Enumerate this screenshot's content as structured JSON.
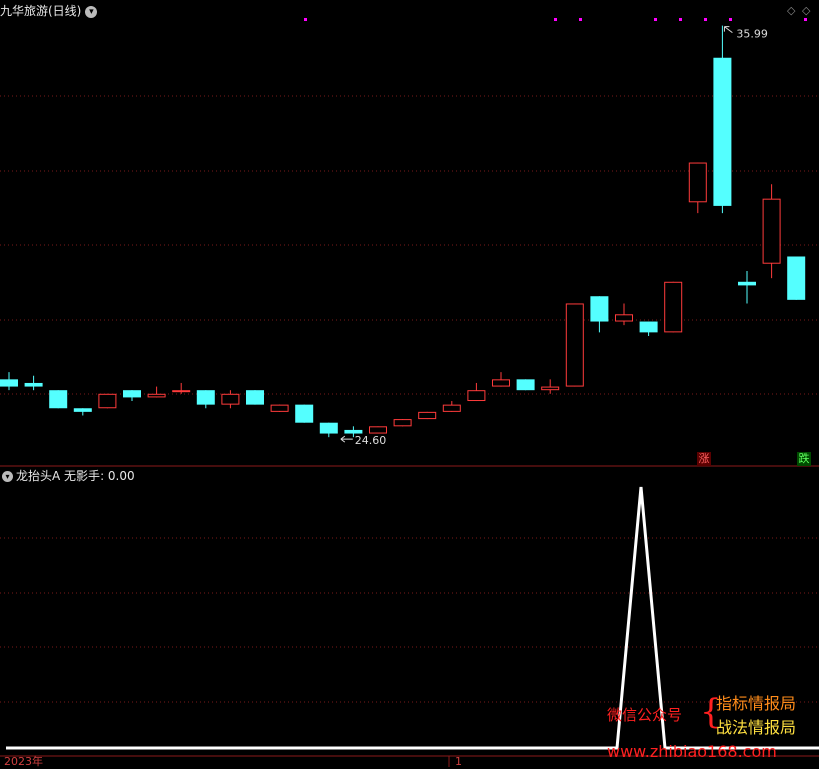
{
  "header": {
    "title": "九华旅游(日线)",
    "menu_icon": "chevron-down-icon"
  },
  "chart_data": [
    {
      "type": "candlestick",
      "title": "九华旅游(日线)",
      "annotations": {
        "high_label": "35.99",
        "low_label": "24.60"
      },
      "ylim": [
        24.3,
        36.2
      ],
      "candles": [
        {
          "o": 26.2,
          "c": 26.0,
          "h": 26.4,
          "l": 25.9
        },
        {
          "o": 26.1,
          "c": 26.0,
          "h": 26.3,
          "l": 25.9
        },
        {
          "o": 25.9,
          "c": 25.4,
          "h": 25.9,
          "l": 25.4
        },
        {
          "o": 25.4,
          "c": 25.3,
          "h": 25.4,
          "l": 25.2
        },
        {
          "o": 25.4,
          "c": 25.8,
          "h": 25.8,
          "l": 25.4
        },
        {
          "o": 25.9,
          "c": 25.7,
          "h": 25.9,
          "l": 25.6
        },
        {
          "o": 25.7,
          "c": 25.8,
          "h": 26.0,
          "l": 25.7
        },
        {
          "o": 25.9,
          "c": 25.9,
          "h": 26.1,
          "l": 25.8
        },
        {
          "o": 25.9,
          "c": 25.5,
          "h": 25.9,
          "l": 25.4
        },
        {
          "o": 25.5,
          "c": 25.8,
          "h": 25.9,
          "l": 25.4
        },
        {
          "o": 25.9,
          "c": 25.5,
          "h": 25.9,
          "l": 25.5
        },
        {
          "o": 25.3,
          "c": 25.5,
          "h": 25.5,
          "l": 25.3
        },
        {
          "o": 25.5,
          "c": 25.0,
          "h": 25.5,
          "l": 25.0
        },
        {
          "o": 25.0,
          "c": 24.7,
          "h": 25.0,
          "l": 24.6
        },
        {
          "o": 24.8,
          "c": 24.7,
          "h": 24.9,
          "l": 24.6
        },
        {
          "o": 24.7,
          "c": 24.9,
          "h": 24.9,
          "l": 24.7
        },
        {
          "o": 24.9,
          "c": 25.1,
          "h": 25.1,
          "l": 24.9
        },
        {
          "o": 25.1,
          "c": 25.3,
          "h": 25.3,
          "l": 25.1
        },
        {
          "o": 25.3,
          "c": 25.5,
          "h": 25.6,
          "l": 25.3
        },
        {
          "o": 25.6,
          "c": 25.9,
          "h": 26.1,
          "l": 25.6
        },
        {
          "o": 26.0,
          "c": 26.2,
          "h": 26.4,
          "l": 26.0
        },
        {
          "o": 26.2,
          "c": 25.9,
          "h": 26.2,
          "l": 25.9
        },
        {
          "o": 25.9,
          "c": 26.0,
          "h": 26.2,
          "l": 25.8
        },
        {
          "o": 26.0,
          "c": 28.3,
          "h": 28.3,
          "l": 26.0
        },
        {
          "o": 28.5,
          "c": 27.8,
          "h": 28.5,
          "l": 27.5
        },
        {
          "o": 27.8,
          "c": 28.0,
          "h": 28.3,
          "l": 27.7
        },
        {
          "o": 27.8,
          "c": 27.5,
          "h": 27.8,
          "l": 27.4
        },
        {
          "o": 27.5,
          "c": 28.9,
          "h": 28.9,
          "l": 27.5
        },
        {
          "o": 31.1,
          "c": 32.2,
          "h": 32.2,
          "l": 30.8
        },
        {
          "o": 35.1,
          "c": 31.0,
          "h": 35.99,
          "l": 30.8
        },
        {
          "o": 28.9,
          "c": 28.8,
          "h": 29.2,
          "l": 28.3
        },
        {
          "o": 29.4,
          "c": 31.2,
          "h": 31.6,
          "l": 29.0
        },
        {
          "o": 29.6,
          "c": 28.4,
          "h": 29.6,
          "l": 28.4
        }
      ]
    },
    {
      "type": "line",
      "title": "龙抬头A",
      "series": [
        {
          "name": "无影手",
          "current": "0.00",
          "values": [
            0,
            0,
            0,
            0,
            0,
            0,
            0,
            0,
            0,
            0,
            0,
            0,
            0,
            0,
            0,
            0,
            0,
            0,
            0,
            0,
            0,
            0,
            0,
            0,
            0,
            1,
            0,
            0,
            0,
            0,
            0,
            0,
            0
          ]
        }
      ],
      "ylim": [
        0,
        1
      ],
      "x_tick_labels": [
        "2023年",
        "1"
      ]
    }
  ],
  "indicator": {
    "name": "龙抬头A",
    "series_label": "无影手",
    "value": "0.00",
    "separator": ": "
  },
  "badges": {
    "up": "涨",
    "down": "跌"
  },
  "watermark": {
    "line1": "微信公众号",
    "line2": "指标情报局",
    "line3": "战法情报局",
    "url": "www.zhibiao168.com",
    "brace": "{"
  },
  "colors": {
    "up": "#ff3b3b",
    "down": "#54ffff",
    "grid": "#7a1a1a",
    "border": "#8b1a1a",
    "signal": "#ffffff",
    "marker": "#ff00ff"
  }
}
